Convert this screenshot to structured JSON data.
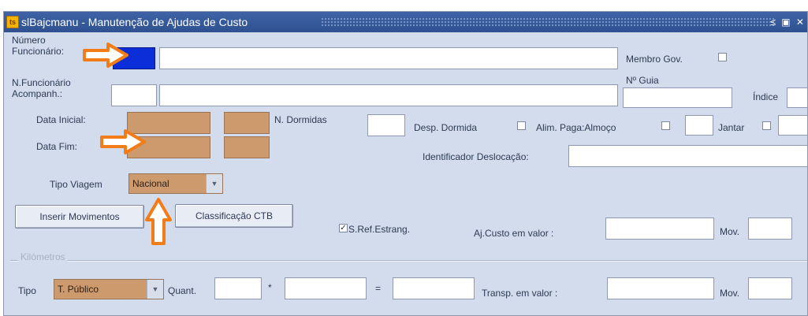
{
  "window": {
    "title": "slBajcmanu - Manutenção de Ajudas de Custo",
    "icon_label": "ts",
    "controls": "≤ ▣ ✕"
  },
  "labels": {
    "numero_funcionario": "Número\nFuncionário",
    "n_funcionario_acompanh": "N.Funcionário\nAcompanh.:",
    "membro_gov": "Membro Gov.",
    "n_guia": "Nº Guia",
    "indice": "Índice",
    "data_inicial": "Data Inicial:",
    "data_fim": "Data Fim:",
    "n_dormidas": "N. Dormidas",
    "desp_dormida": "Desp. Dormida",
    "alim_paga_almoco": "Alim. Paga:Almoço",
    "jantar": "Jantar",
    "identificador_deslocacao": "Identificador Deslocação:",
    "tipo_viagem": "Tipo Viagem",
    "s_ref_estrang": "S.Ref.Estrang.",
    "aj_custo_em_valor": "Aj.Custo em valor :",
    "mov": "Mov.",
    "kilometros_section": "Kilómetros",
    "tipo": "Tipo",
    "quant": "Quant.",
    "multiply": "*",
    "equals": "=",
    "transp_em_valor": "Transp. em valor :",
    "mov2": "Mov."
  },
  "selects": {
    "tipo_viagem": "Nacional",
    "tipo_km": "T. Público"
  },
  "buttons": {
    "inserir_movimentos": "Inserir Movimentos",
    "classificacao_ctb": "Classificação CTB"
  },
  "checkboxes": {
    "s_ref_estrang_checked": true
  },
  "annotations": {
    "arrow_color": "#f27d18"
  }
}
